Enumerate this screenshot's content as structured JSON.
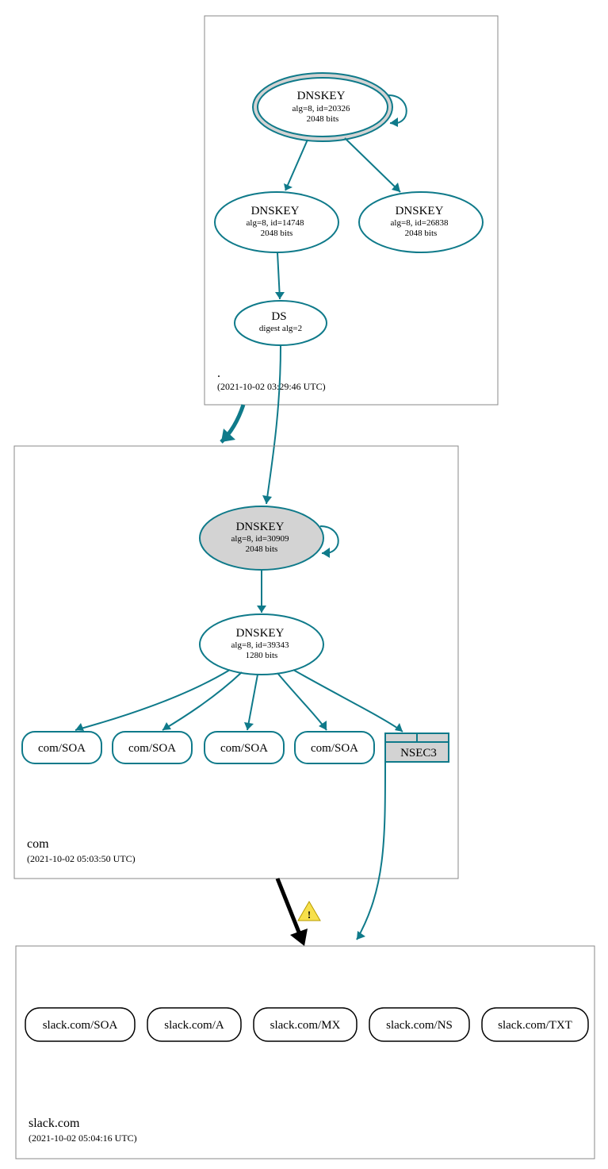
{
  "zones": {
    "root": {
      "name": ".",
      "timestamp": "(2021-10-02 03:29:46 UTC)",
      "nodes": {
        "ksk": {
          "title": "DNSKEY",
          "line2": "alg=8, id=20326",
          "line3": "2048 bits"
        },
        "zsk1": {
          "title": "DNSKEY",
          "line2": "alg=8, id=14748",
          "line3": "2048 bits"
        },
        "zsk2": {
          "title": "DNSKEY",
          "line2": "alg=8, id=26838",
          "line3": "2048 bits"
        },
        "ds": {
          "title": "DS",
          "line2": "digest alg=2"
        }
      }
    },
    "com": {
      "name": "com",
      "timestamp": "(2021-10-02 05:03:50 UTC)",
      "nodes": {
        "ksk": {
          "title": "DNSKEY",
          "line2": "alg=8, id=30909",
          "line3": "2048 bits"
        },
        "zsk": {
          "title": "DNSKEY",
          "line2": "alg=8, id=39343",
          "line3": "1280 bits"
        },
        "soa1": "com/SOA",
        "soa2": "com/SOA",
        "soa3": "com/SOA",
        "soa4": "com/SOA",
        "nsec3": "NSEC3"
      }
    },
    "slack": {
      "name": "slack.com",
      "timestamp": "(2021-10-02 05:04:16 UTC)",
      "nodes": {
        "soa": "slack.com/SOA",
        "a": "slack.com/A",
        "mx": "slack.com/MX",
        "ns": "slack.com/NS",
        "txt": "slack.com/TXT"
      }
    }
  }
}
